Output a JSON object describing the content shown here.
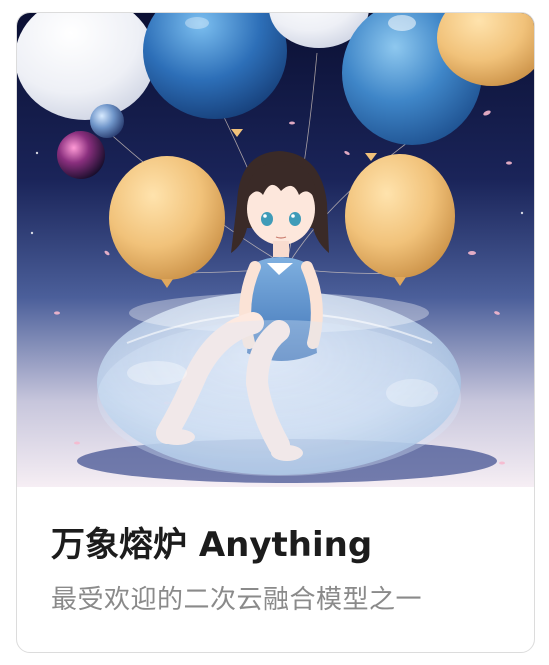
{
  "card": {
    "title": "万象熔炉 Anything",
    "subtitle": "最受欢迎的二次云融合模型之一"
  },
  "colors": {
    "title": "#1c1c1c",
    "subtitle": "#8a8a8a",
    "border": "#dcdcdc",
    "sky_top": "#0e1238",
    "sky_bottom": "#f3ecf2",
    "balloon_blue": "#3f86c8",
    "balloon_gold": "#f1c27a",
    "balloon_white": "#f2f3f7"
  }
}
